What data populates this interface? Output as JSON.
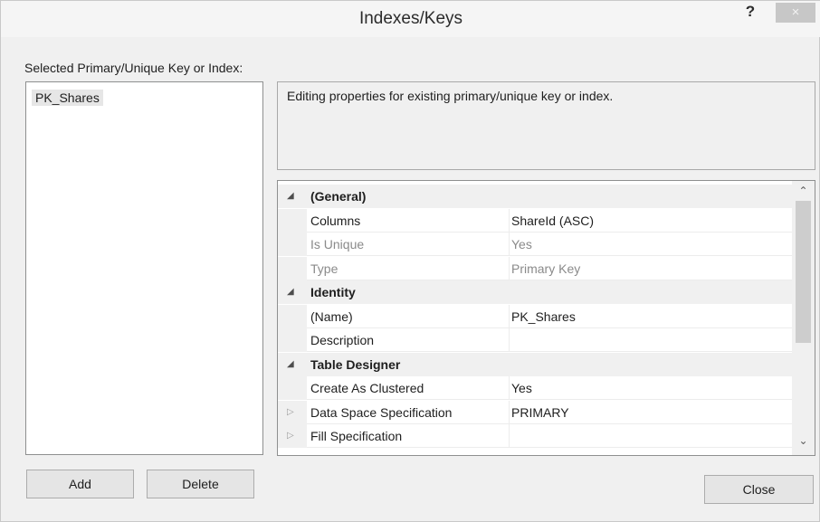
{
  "window": {
    "title": "Indexes/Keys",
    "help_label": "?",
    "close_glyph": "×"
  },
  "key_list": {
    "label": "Selected Primary/Unique Key or Index:",
    "items": [
      "PK_Shares"
    ]
  },
  "description": "Editing properties for existing primary/unique key or index.",
  "properties": {
    "rows": [
      {
        "kind": "category",
        "name": "(General)",
        "value": ""
      },
      {
        "kind": "item",
        "name": "Columns",
        "value": "ShareId (ASC)"
      },
      {
        "kind": "item-disabled",
        "name": "Is Unique",
        "value": "Yes"
      },
      {
        "kind": "item-disabled",
        "name": "Type",
        "value": "Primary Key"
      },
      {
        "kind": "category",
        "name": "Identity",
        "value": ""
      },
      {
        "kind": "item",
        "name": "(Name)",
        "value": "PK_Shares"
      },
      {
        "kind": "item",
        "name": "Description",
        "value": ""
      },
      {
        "kind": "category",
        "name": "Table Designer",
        "value": ""
      },
      {
        "kind": "item",
        "name": "Create As Clustered",
        "value": "Yes"
      },
      {
        "kind": "item-expandable",
        "name": "Data Space Specification",
        "value": "PRIMARY"
      },
      {
        "kind": "item-expandable",
        "name": "Fill Specification",
        "value": ""
      }
    ]
  },
  "buttons": {
    "add": "Add",
    "delete": "Delete",
    "close": "Close"
  },
  "icons": {
    "expanded": "expanded-triangle-icon",
    "collapsed": "collapsed-triangle-icon",
    "scroll_up": "scroll-up-arrow-icon",
    "scroll_down": "scroll-down-arrow-icon"
  }
}
